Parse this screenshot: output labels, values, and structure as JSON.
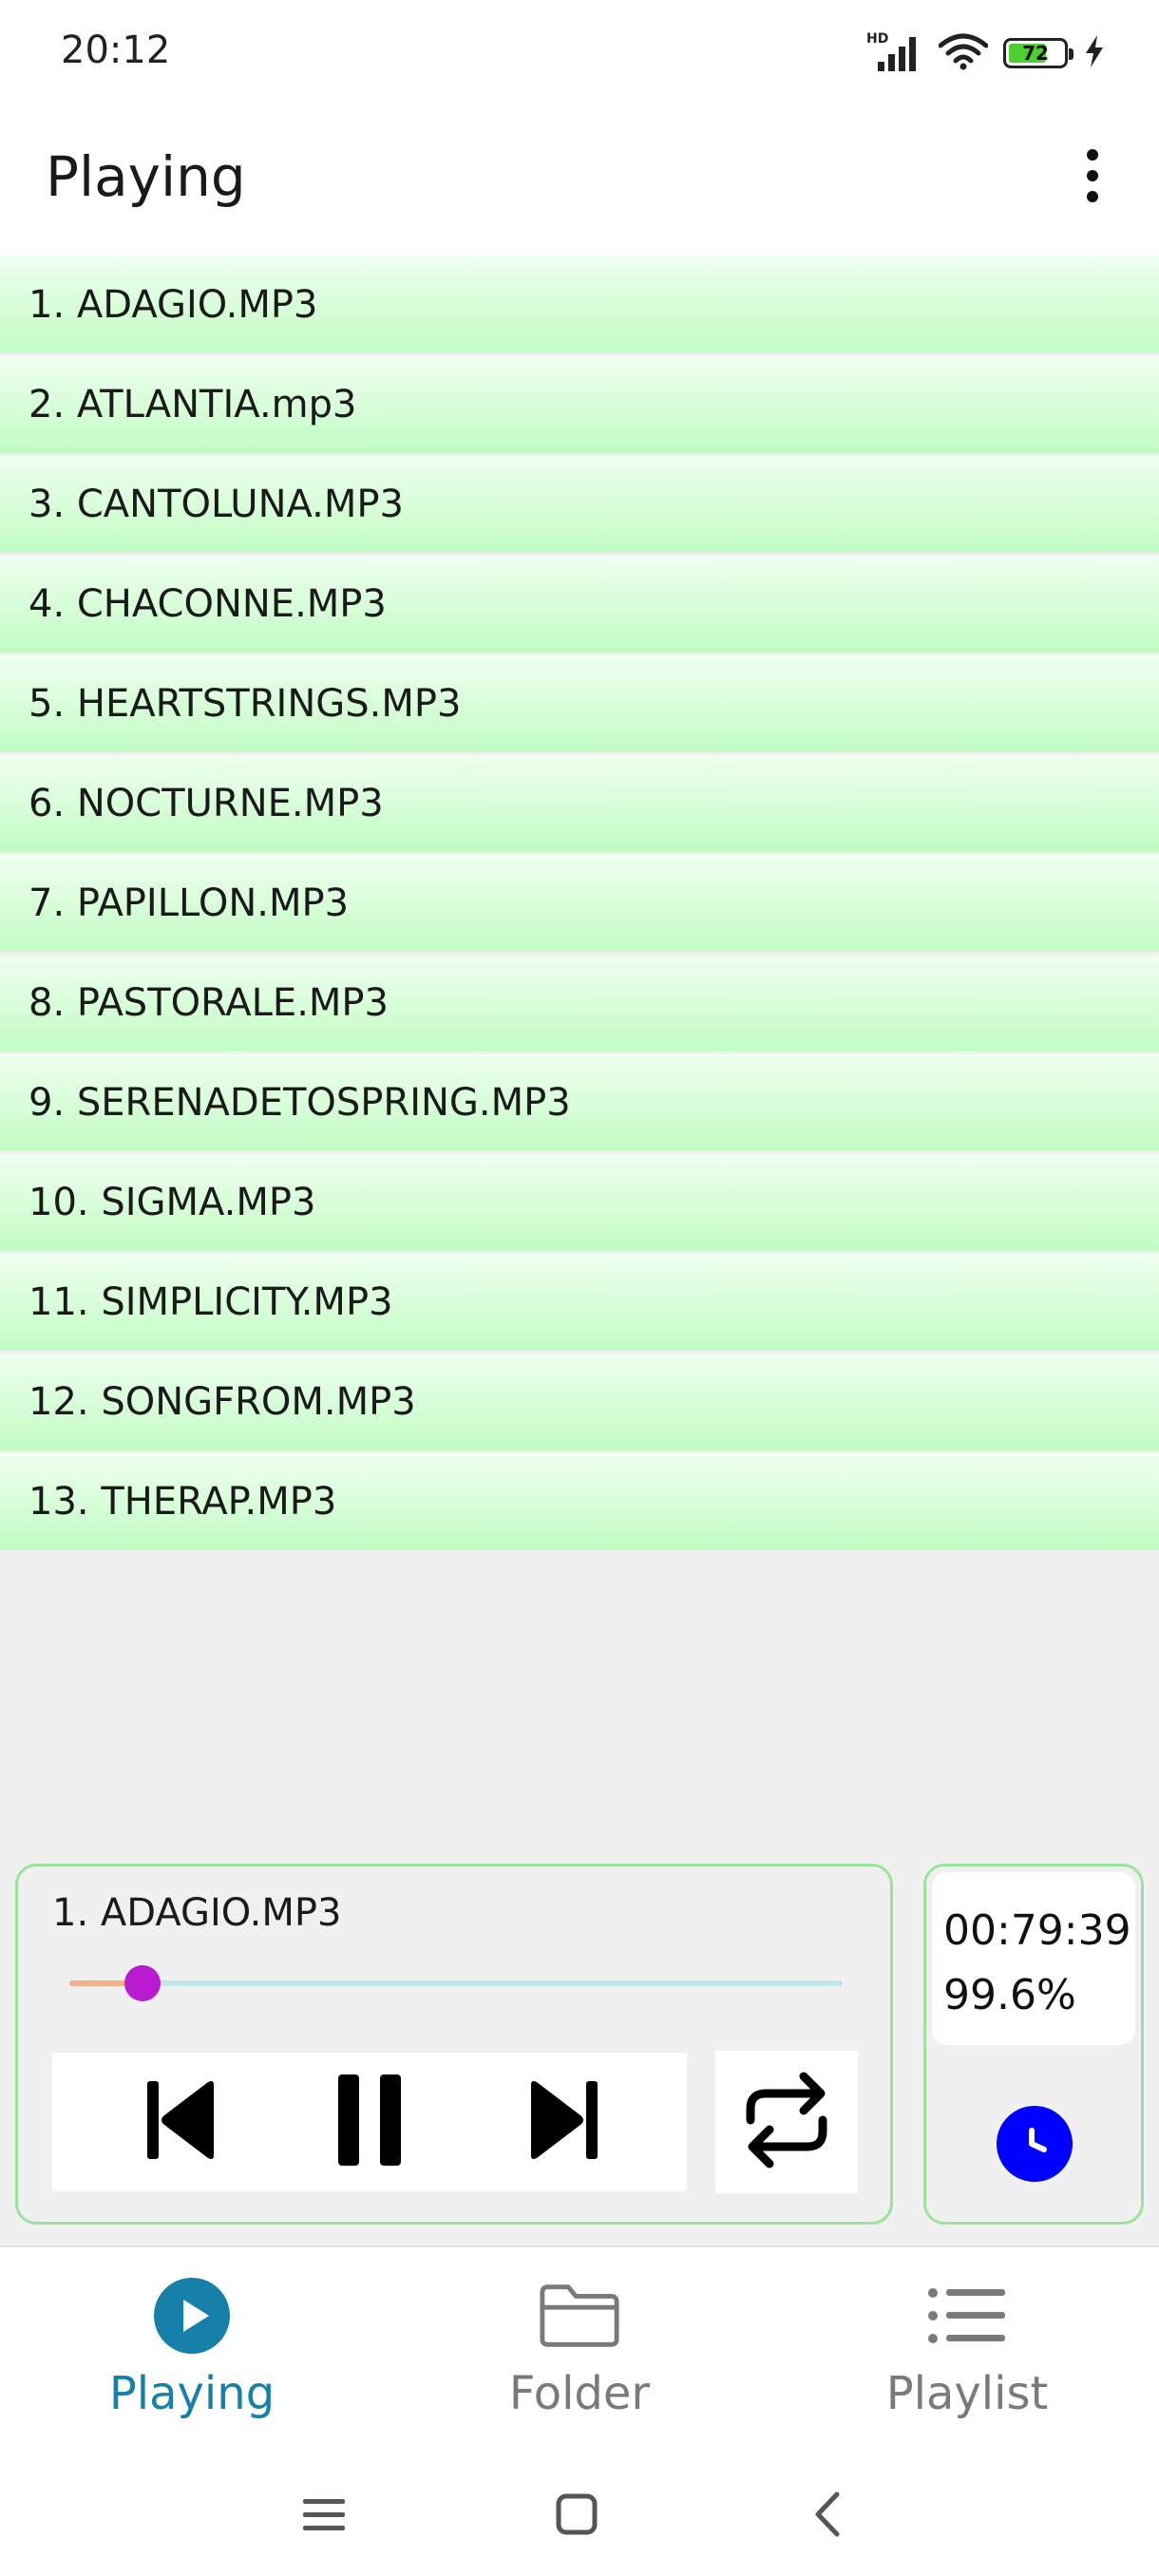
{
  "status_bar": {
    "time": "20:12",
    "network_badge": "HD",
    "battery_level": "72",
    "battery_fraction": 0.72
  },
  "app_bar": {
    "title": "Playing",
    "menu_icon": "more-vert-icon"
  },
  "tracks": [
    {
      "label": "1. ADAGIO.MP3"
    },
    {
      "label": "2. ATLANTIA.mp3"
    },
    {
      "label": "3. CANTOLUNA.MP3"
    },
    {
      "label": "4. CHACONNE.MP3"
    },
    {
      "label": "5. HEARTSTRINGS.MP3"
    },
    {
      "label": "6. NOCTURNE.MP3"
    },
    {
      "label": "7. PAPILLON.MP3"
    },
    {
      "label": "8. PASTORALE.MP3"
    },
    {
      "label": "9. SERENADETOSPRING.MP3"
    },
    {
      "label": "10. SIGMA.MP3"
    },
    {
      "label": "11. SIMPLICITY.MP3"
    },
    {
      "label": "12. SONGFROM.MP3"
    },
    {
      "label": "13. THERAP.MP3"
    }
  ],
  "player": {
    "now_playing": "1. ADAGIO.MP3",
    "progress_fraction": 0.094,
    "controls": {
      "previous_icon": "skip-previous-icon",
      "pause_icon": "pause-icon",
      "next_icon": "skip-next-icon",
      "repeat_icon": "repeat-icon"
    }
  },
  "timer": {
    "time": "00:79:39",
    "percent": "99.6%",
    "clock_icon": "clock-icon"
  },
  "bottom_nav": {
    "items": [
      {
        "label": "Playing",
        "icon": "play-circle-icon",
        "active": true
      },
      {
        "label": "Folder",
        "icon": "folder-icon",
        "active": false
      },
      {
        "label": "Playlist",
        "icon": "playlist-icon",
        "active": false
      }
    ]
  },
  "system_nav": {
    "recents_icon": "menu-icon",
    "home_icon": "home-square-icon",
    "back_icon": "back-chevron-icon"
  },
  "colors": {
    "accent": "#1680a8",
    "inactive": "#7a7a7a",
    "seek_thumb": "#b91bd1",
    "clock_button": "#0000ff",
    "panel_border": "#9ae39c"
  }
}
